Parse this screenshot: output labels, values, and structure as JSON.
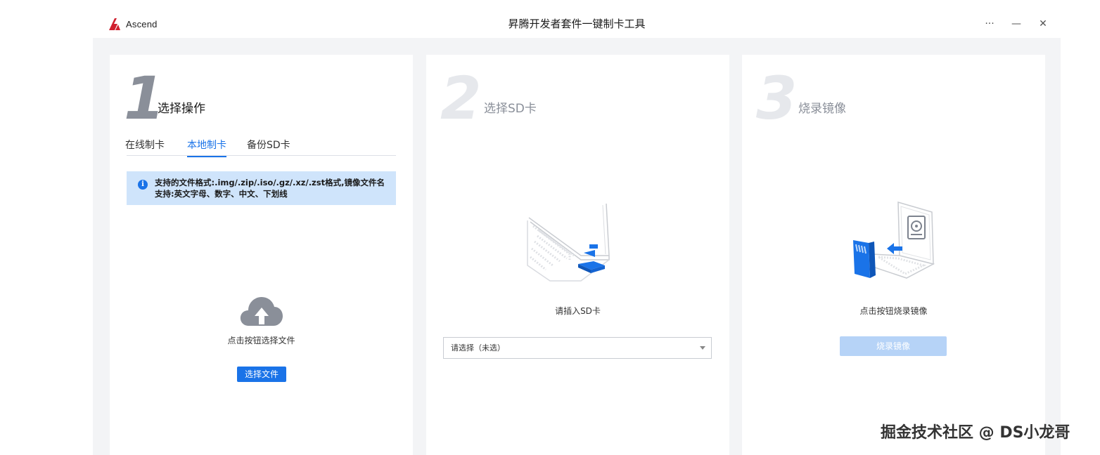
{
  "window": {
    "brand": "Ascend",
    "title": "昇腾开发者套件一键制卡工具",
    "more_label": "···",
    "minimize_label": "—",
    "close_label": "✕"
  },
  "step1": {
    "number": "1",
    "title": "选择操作",
    "tabs": [
      {
        "label": "在线制卡"
      },
      {
        "label": "本地制卡"
      },
      {
        "label": "备份SD卡"
      }
    ],
    "active_tab": "本地制卡",
    "info_text": "支持的文件格式:.img/.zip/.iso/.gz/.xz/.zst格式,镜像文件名支持:英文字母、数字、中文、下划线",
    "upload_caption": "点击按钮选择文件",
    "select_file_button": "选择文件"
  },
  "step2": {
    "number": "2",
    "title": "选择SD卡",
    "caption": "请插入SD卡",
    "select_value": "请选择（未选）"
  },
  "step3": {
    "number": "3",
    "title": "烧录镜像",
    "caption": "点击按钮烧录镜像",
    "burn_button": "烧录镜像"
  },
  "watermark": "掘金技术社区 @ DS小龙哥",
  "colors": {
    "accent": "#1a73e8",
    "info_bg": "#cfe4fb",
    "step_active": "#8a8f99",
    "step_inactive": "#e6e8ec",
    "disabled_button": "#b6d3f7",
    "logo_red": "#d0202f"
  }
}
